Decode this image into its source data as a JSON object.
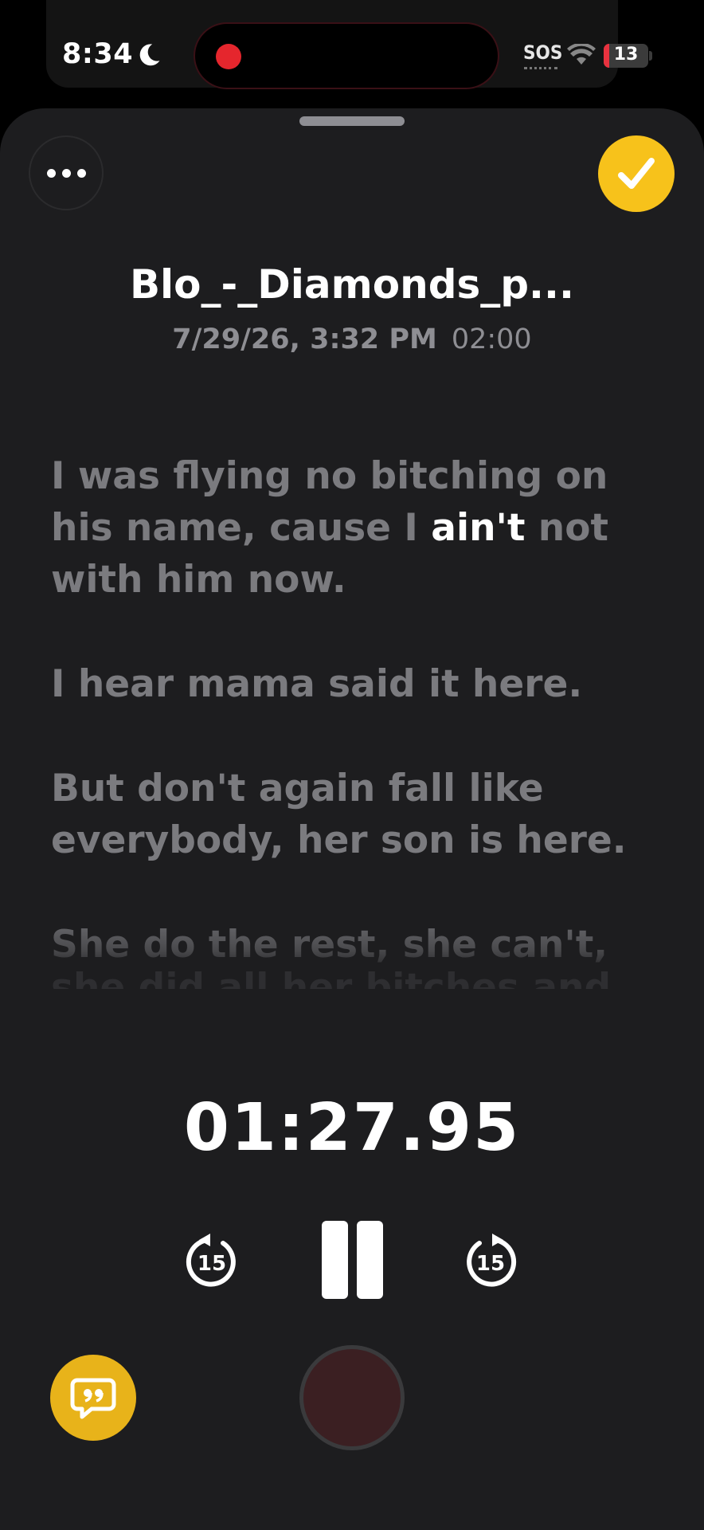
{
  "status_bar": {
    "time": "8:34",
    "sos": "SOS",
    "battery_level": "13",
    "battery_fraction": 0.13
  },
  "header": {
    "title": "Blo_-_Diamonds_p...",
    "date": "7/29/26, 3:32 PM",
    "duration": "02:00"
  },
  "lyrics": {
    "line1_before": "I was flying no bitching on his name, cause I ",
    "line1_highlight": "ain't",
    "line1_after": " not with him now.",
    "line2": "I hear mama said it here.",
    "line3": "But don't again fall like everybody, her son is here.",
    "line4": "She do the rest, she can't, but",
    "line5": "she did all her bitches and she said"
  },
  "player": {
    "elapsed": "01:27.95",
    "skip_back_label": "15",
    "skip_forward_label": "15"
  },
  "colors": {
    "accent": "#f7c21b",
    "sheet_bg": "#1d1d1f",
    "muted_text": "#7b7b7f",
    "record_red": "#e5262d"
  },
  "icons": [
    "moon-icon",
    "wifi-icon",
    "more-icon",
    "checkmark-icon",
    "skip-back-15-icon",
    "pause-icon",
    "skip-forward-15-icon",
    "transcript-quote-icon",
    "record-icon"
  ]
}
